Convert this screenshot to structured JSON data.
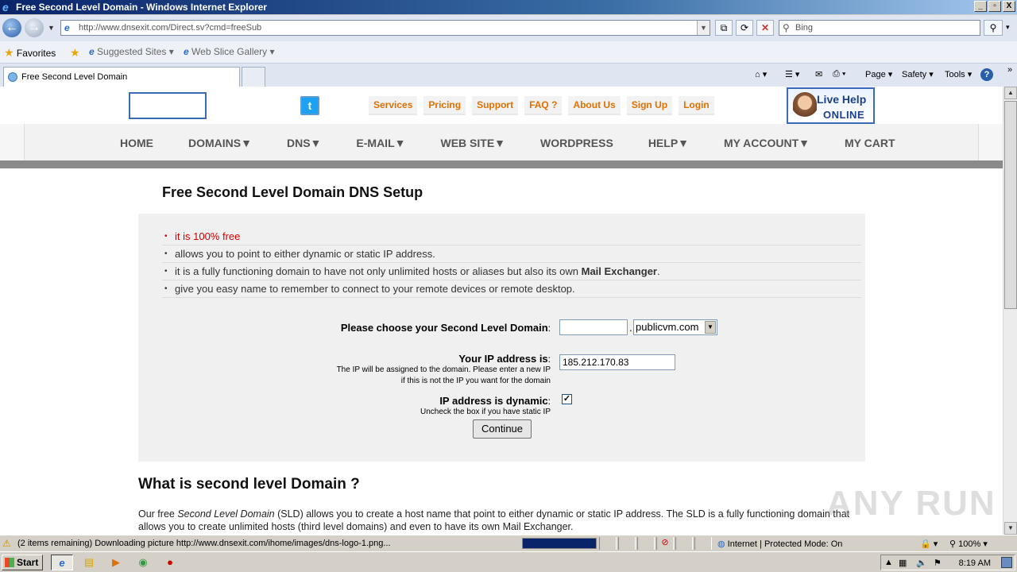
{
  "window": {
    "title": "Free Second Level Domain - Windows Internet Explorer",
    "buttons": [
      "_",
      "▫",
      "X"
    ]
  },
  "address_bar": {
    "url": "http://www.dnsexit.com/Direct.sv?cmd=freeSub",
    "search_placeholder": "Bing"
  },
  "favorites_bar": {
    "favorites": "Favorites",
    "suggested": "Suggested Sites ▾",
    "webslice": "Web Slice Gallery ▾"
  },
  "tab": {
    "title": "Free Second Level Domain"
  },
  "command_bar": {
    "page": "Page ▾",
    "safety": "Safety ▾",
    "tools": "Tools ▾",
    "help": "?"
  },
  "site": {
    "top_links": [
      "Services",
      "Pricing",
      "Support",
      "FAQ ?",
      "About Us",
      "Sign Up",
      "Login"
    ],
    "live_help": {
      "line1": "Live Help",
      "line2": "ONLINE"
    },
    "nav": [
      {
        "label": "HOME",
        "caret": false
      },
      {
        "label": "DOMAINS",
        "caret": true
      },
      {
        "label": "DNS",
        "caret": true
      },
      {
        "label": "E-MAIL",
        "caret": true
      },
      {
        "label": "WEB SITE",
        "caret": true
      },
      {
        "label": "WORDPRESS",
        "caret": false
      },
      {
        "label": "HELP",
        "caret": true
      },
      {
        "label": "MY ACCOUNT",
        "caret": true
      },
      {
        "label": "MY CART",
        "caret": false
      }
    ]
  },
  "main": {
    "title": "Free Second Level Domain DNS Setup",
    "bullets": [
      {
        "text": "it is 100% free",
        "highlight": true
      },
      {
        "text": "allows you to point to either dynamic or static IP address."
      },
      {
        "text": "it is a fully functioning domain to have not only unlimited hosts or aliases but also its own ",
        "bold_suffix": "Mail Exchanger",
        "suffix": "."
      },
      {
        "text": "give you easy name to remember to connect to your remote devices or remote desktop."
      }
    ],
    "form": {
      "sld_label": "Please choose your Second Level Domain",
      "sld_value": "",
      "sld_dot": ".",
      "sld_suffix": "publicvm.com",
      "ip_label": "Your IP address is",
      "ip_help": "The IP will be assigned to the domain. Please enter a new IP if this is not the IP you want for the domain",
      "ip_value": "185.212.170.83",
      "dynamic_label": "IP address is dynamic",
      "dynamic_help": "Uncheck the box if you have static IP",
      "dynamic_checked": true,
      "continue_label": "Continue"
    },
    "what_is_title": "What is second level Domain ?",
    "what_is_text_1": "Our free ",
    "what_is_text_em": "Second Level Domain",
    "what_is_text_2": " (SLD) allows you to create a host name that point to either dynamic or static IP address. The SLD is a fully functioning domain that allows you to create unlimited hosts (third level domains) and even to have its own Mail Exchanger."
  },
  "watermark": "ANY RUN",
  "status_bar": {
    "message": "(2 items remaining) Downloading picture http://www.dnsexit.com/ihome/images/dns-logo-1.png...",
    "zone": "Internet | Protected Mode: On",
    "zoom": "100%",
    "progress": 1.0
  },
  "taskbar": {
    "start": "Start",
    "clock": "8:19 AM"
  }
}
